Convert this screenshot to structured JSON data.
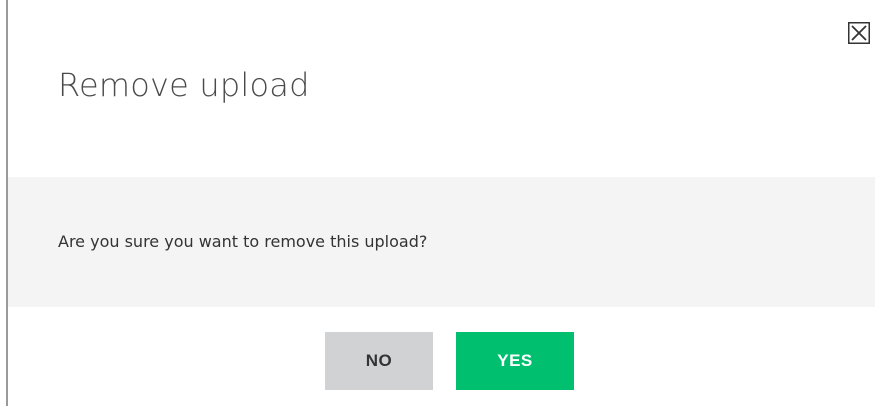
{
  "dialog": {
    "title": "Remove upload",
    "message": "Are you sure you want to remove this upload?",
    "close_icon": "close-icon",
    "buttons": {
      "no_label": "NO",
      "yes_label": "YES"
    }
  },
  "colors": {
    "primary_green": "#00bf6f",
    "secondary_gray": "#d0d2d4",
    "body_band": "#f4f4f4",
    "title_text": "#4a4a4a"
  }
}
